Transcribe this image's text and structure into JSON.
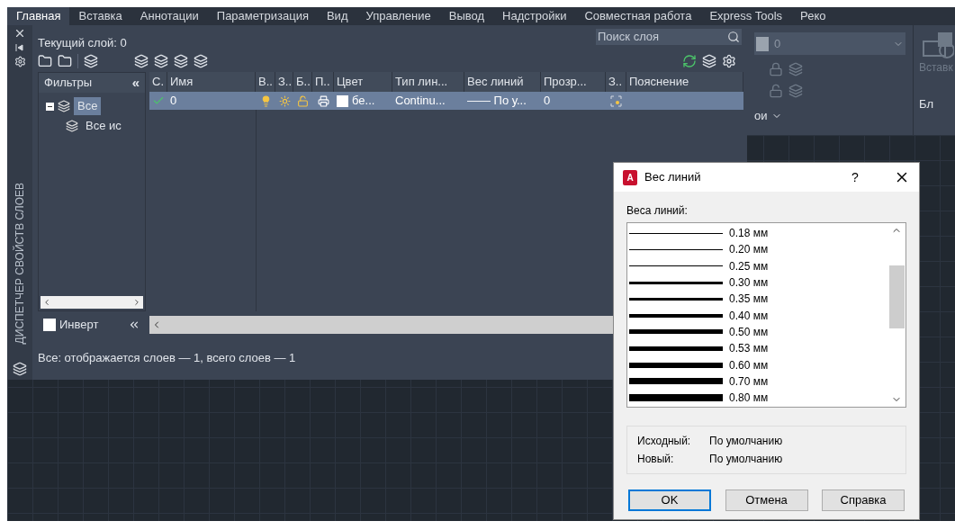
{
  "ribbon_tabs": [
    {
      "label": "Главная",
      "selected": true
    },
    {
      "label": "Вставка",
      "selected": false
    },
    {
      "label": "Аннотации",
      "selected": false
    },
    {
      "label": "Параметризация",
      "selected": false
    },
    {
      "label": "Вид",
      "selected": false
    },
    {
      "label": "Управление",
      "selected": false
    },
    {
      "label": "Вывод",
      "selected": false
    },
    {
      "label": "Надстройки",
      "selected": false
    },
    {
      "label": "Совместная работа",
      "selected": false
    },
    {
      "label": "Express Tools",
      "selected": false
    },
    {
      "label": "Реко",
      "selected": false
    }
  ],
  "ribbon": {
    "layer_combo": "0",
    "insert_label": "Вставк",
    "layers_panel_label": "ои",
    "block_panel_label": "Бл"
  },
  "palette": {
    "side_title": "ДИСПЕТЧЕР СВОЙСТВ СЛОЕВ",
    "current_layer": "Текущий слой: 0",
    "search": {
      "placeholder": "Поиск слоя"
    },
    "filters_title": "Фильтры",
    "collapse": "«",
    "filter_tree": [
      {
        "label": "Все",
        "selected": true,
        "expanded": true,
        "children": [
          {
            "label": "Все ис",
            "selected": false
          }
        ]
      }
    ],
    "columns": [
      "С.",
      "Имя",
      "В..",
      "З..",
      "Б..",
      "П..",
      "Цвет",
      "Тип лин...",
      "Вес линий",
      "Прозр...",
      "З..",
      "Пояснение"
    ],
    "rows": [
      {
        "selected": true,
        "current": true,
        "name": "0",
        "on": true,
        "frozen": false,
        "locked": false,
        "plot": true,
        "color_name": "бе...",
        "linetype": "Continu...",
        "lineweight": "—— По у...",
        "transparency": "0"
      }
    ],
    "invert": {
      "label": "Инверт",
      "checked": false
    },
    "status": "Все: отображается слоев — 1, всего слоев — 1"
  },
  "dialog": {
    "logo_letter": "A",
    "title": "Вес линий",
    "help": "?",
    "list_label": "Веса линий:",
    "lineweights": [
      {
        "label": "0.18 мм"
      },
      {
        "label": "0.20 мм"
      },
      {
        "label": "0.25 мм"
      },
      {
        "label": "0.30 мм"
      },
      {
        "label": "0.35 мм"
      },
      {
        "label": "0.40 мм"
      },
      {
        "label": "0.50 мм"
      },
      {
        "label": "0.53 мм"
      },
      {
        "label": "0.60 мм"
      },
      {
        "label": "0.70 мм"
      },
      {
        "label": "0.80 мм"
      }
    ],
    "info": [
      {
        "label": "Исходный:",
        "value": "По умолчанию"
      },
      {
        "label": "Новый:",
        "value": "По умолчанию"
      }
    ],
    "buttons": [
      {
        "label": "OK",
        "default": true
      },
      {
        "label": "Отмена",
        "default": false
      },
      {
        "label": "Справка",
        "default": false
      }
    ]
  }
}
